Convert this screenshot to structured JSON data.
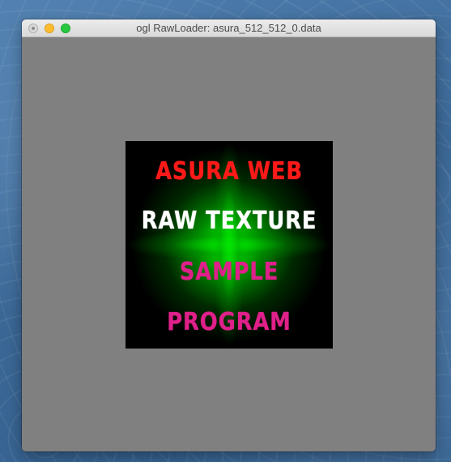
{
  "window": {
    "title": "ogl RawLoader: asura_512_512_0.data",
    "controls": {
      "close": "close-button",
      "minimize": "minimize-button",
      "zoom": "zoom-button"
    }
  },
  "texture": {
    "lines": [
      {
        "text": "ASURA WEB",
        "color": "#ff1a1a"
      },
      {
        "text": "RAW TEXTURE",
        "color": "#ffffff"
      },
      {
        "text": "SAMPLE",
        "color": "#e0208a"
      },
      {
        "text": "PROGRAM",
        "color": "#e0208a"
      }
    ],
    "background": "#000000",
    "glow_color": "#00ff00"
  },
  "viewport_background": "#808080"
}
